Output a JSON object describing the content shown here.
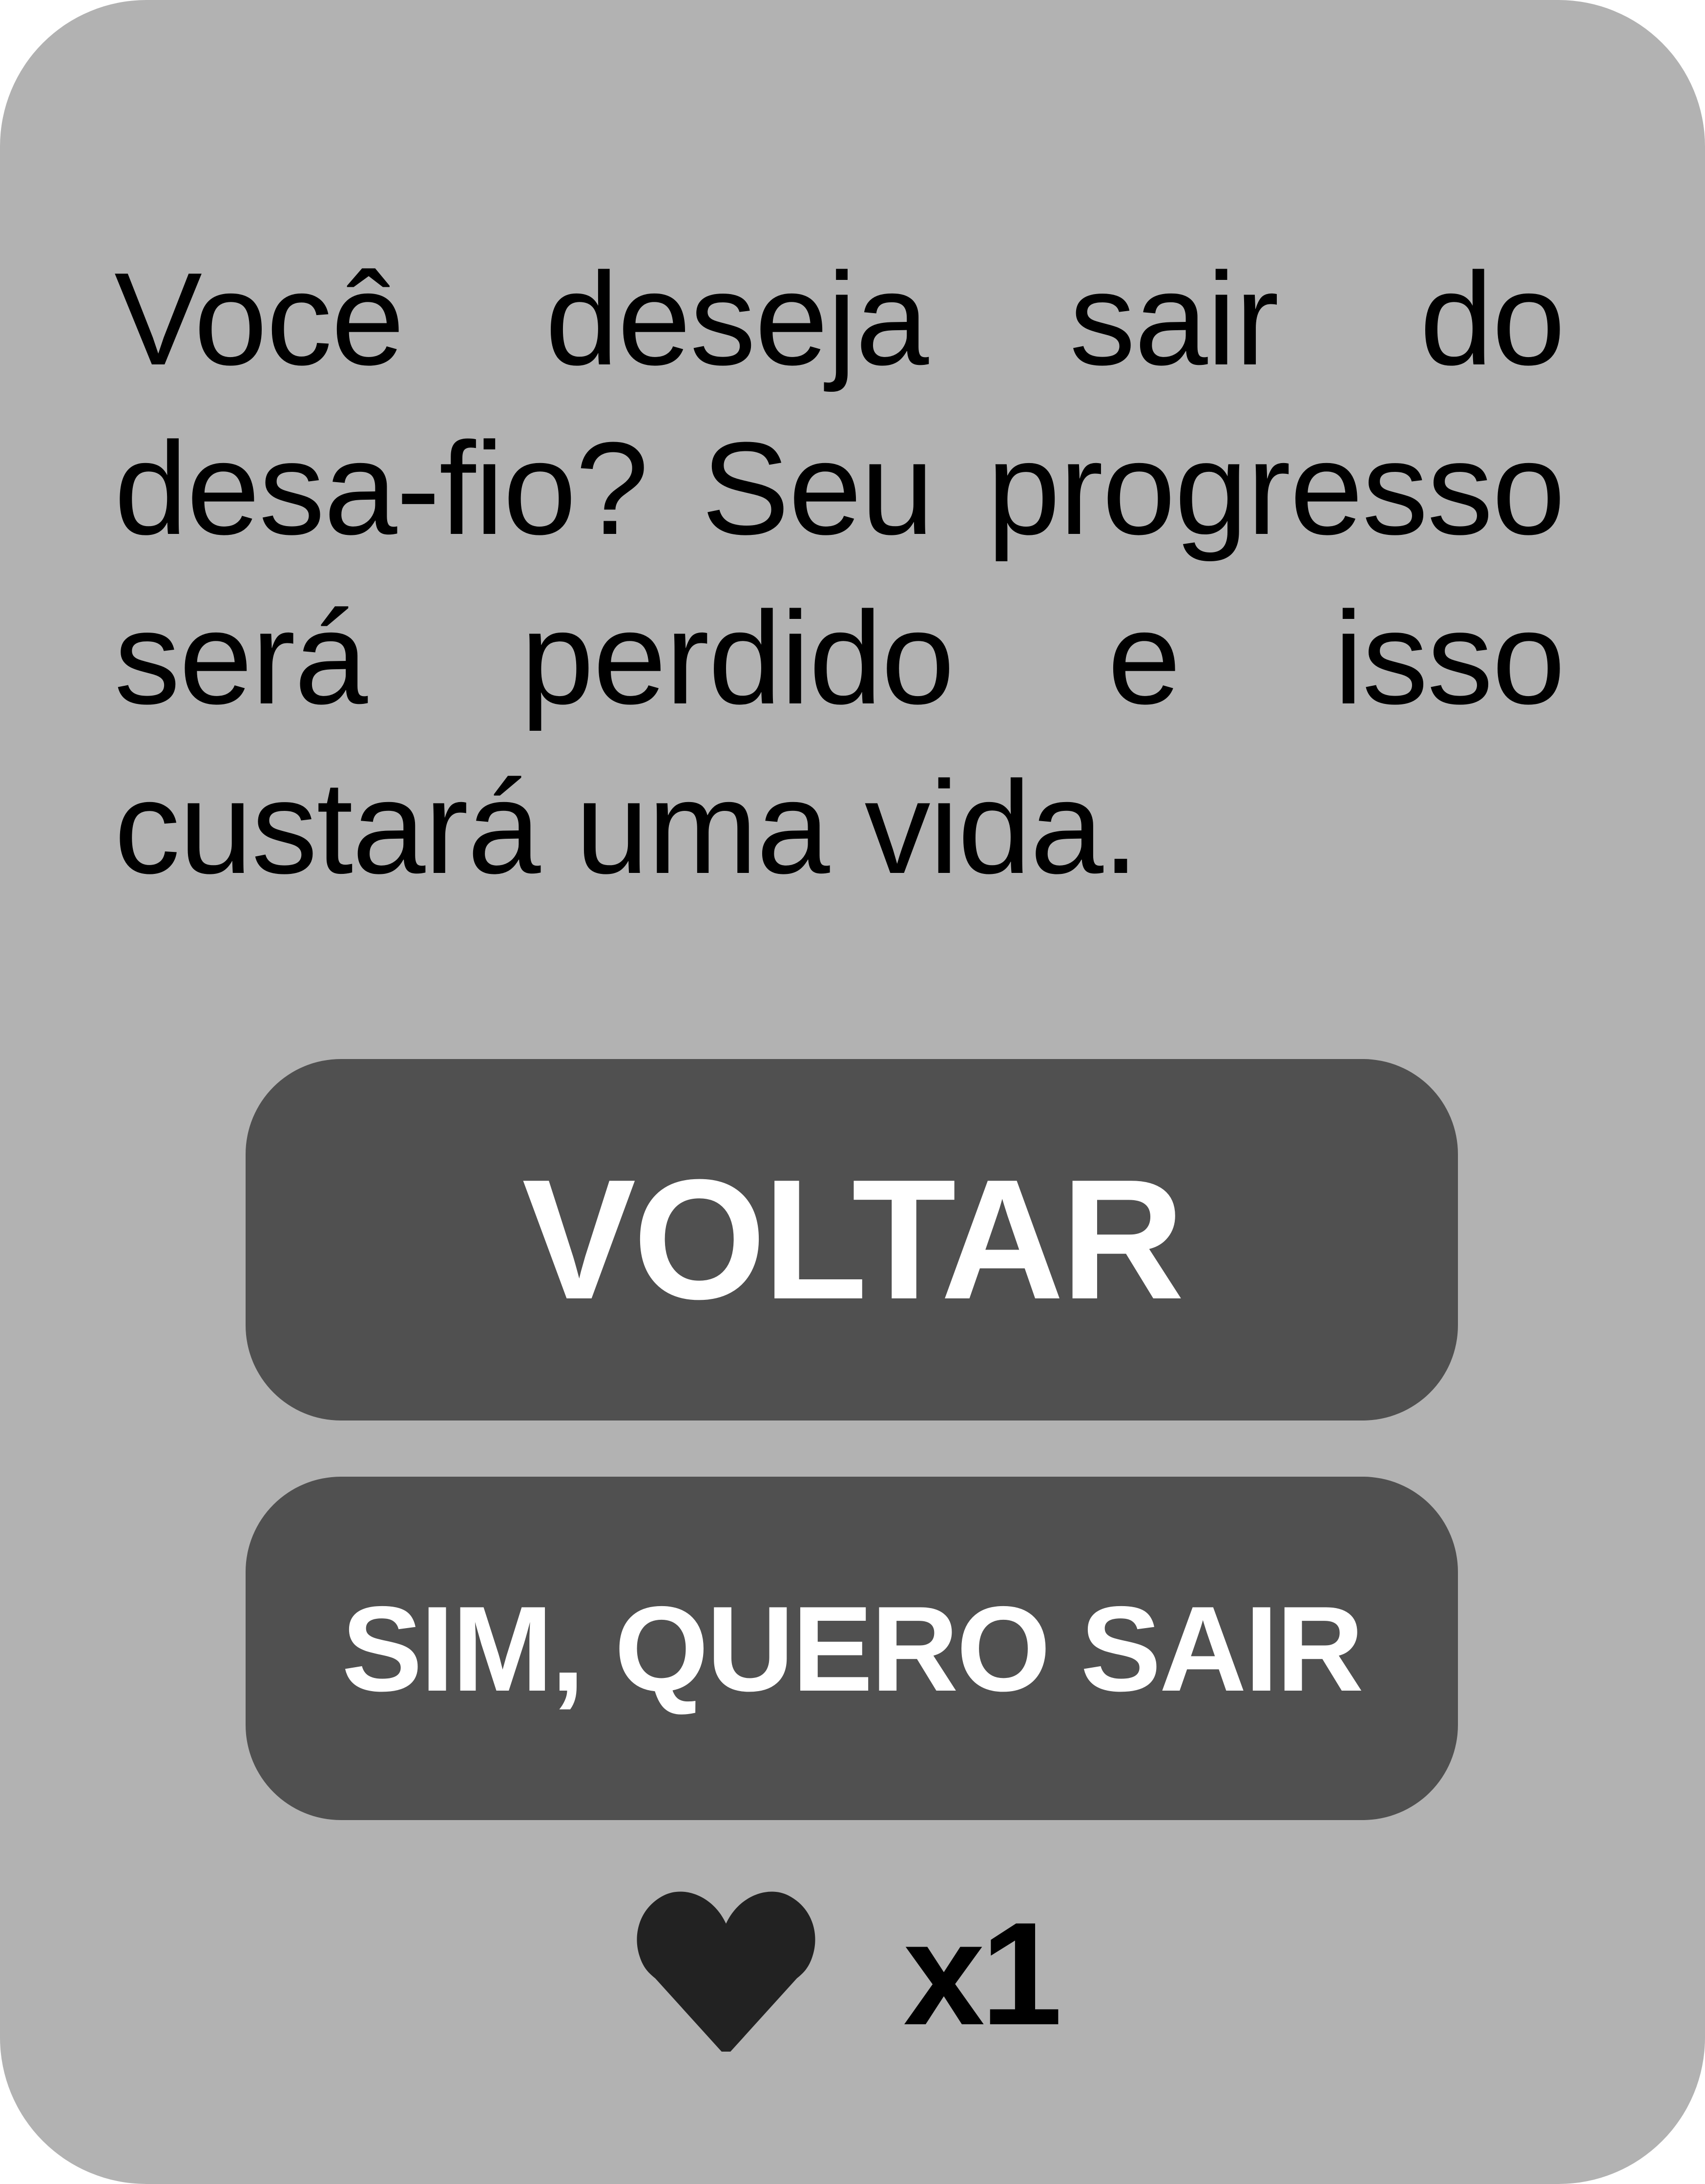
{
  "dialog": {
    "message": "Você deseja sair do desa-fio? Seu progresso será perdido e isso custará uma vida.",
    "back_button_label": "VOLTAR",
    "exit_button_label": "SIM, QUERO SAIR",
    "lives_cost": "x1",
    "lives_icon": "heart-icon"
  },
  "colors": {
    "card_background": "#b2b2b2",
    "button_background": "#505050",
    "button_text": "#ffffff",
    "text": "#000000",
    "heart": "#222222"
  }
}
